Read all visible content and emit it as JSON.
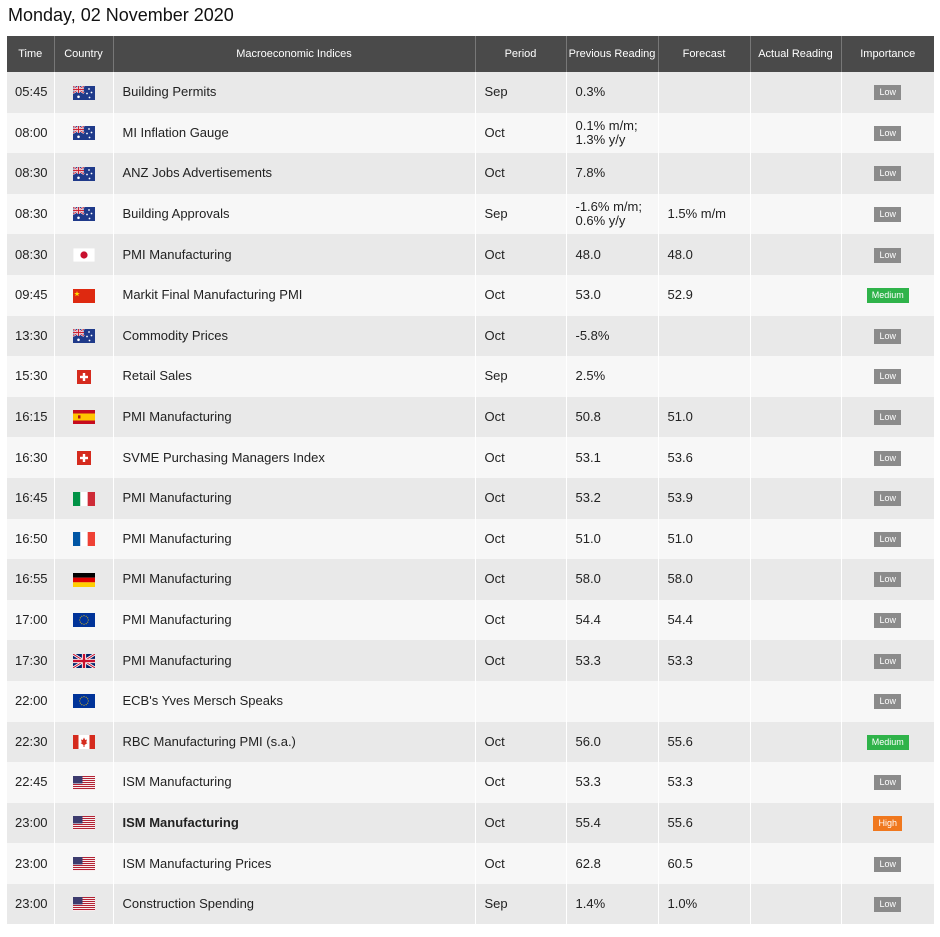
{
  "page": {
    "title": "Monday, 02 November 2020"
  },
  "table": {
    "headers": {
      "time": "Time",
      "country": "Country",
      "index": "Macroeconomic Indices",
      "period": "Period",
      "previous": "Previous Reading",
      "forecast": "Forecast",
      "actual": "Actual Reading",
      "importance": "Importance"
    },
    "rows": [
      {
        "time": "05:45",
        "flag": "australia-flag-icon",
        "index": "Building Permits",
        "period": "Sep",
        "previous": "0.3%",
        "forecast": "",
        "actual": "",
        "importance": "Low"
      },
      {
        "time": "08:00",
        "flag": "australia-flag-icon",
        "index": "MI Inflation Gauge",
        "period": "Oct",
        "previous": "0.1% m/m; 1.3% y/y",
        "forecast": "",
        "actual": "",
        "importance": "Low"
      },
      {
        "time": "08:30",
        "flag": "australia-flag-icon",
        "index": "ANZ Jobs Advertisements",
        "period": "Oct",
        "previous": "7.8%",
        "forecast": "",
        "actual": "",
        "importance": "Low"
      },
      {
        "time": "08:30",
        "flag": "australia-flag-icon",
        "index": "Building Approvals",
        "period": "Sep",
        "previous": "-1.6% m/m; 0.6% y/y",
        "forecast": "1.5% m/m",
        "actual": "",
        "importance": "Low"
      },
      {
        "time": "08:30",
        "flag": "japan-flag-icon",
        "index": "PMI Manufacturing",
        "period": "Oct",
        "previous": "48.0",
        "forecast": "48.0",
        "actual": "",
        "importance": "Low"
      },
      {
        "time": "09:45",
        "flag": "china-flag-icon",
        "index": "Markit Final Manufacturing PMI",
        "period": "Oct",
        "previous": "53.0",
        "forecast": "52.9",
        "actual": "",
        "importance": "Medium"
      },
      {
        "time": "13:30",
        "flag": "australia-flag-icon",
        "index": "Commodity Prices",
        "period": "Oct",
        "previous": "-5.8%",
        "forecast": "",
        "actual": "",
        "importance": "Low"
      },
      {
        "time": "15:30",
        "flag": "switzerland-flag-icon",
        "index": "Retail Sales",
        "period": "Sep",
        "previous": "2.5%",
        "forecast": "",
        "actual": "",
        "importance": "Low"
      },
      {
        "time": "16:15",
        "flag": "spain-flag-icon",
        "index": "PMI Manufacturing",
        "period": "Oct",
        "previous": "50.8",
        "forecast": "51.0",
        "actual": "",
        "importance": "Low"
      },
      {
        "time": "16:30",
        "flag": "switzerland-flag-icon",
        "index": "SVME Purchasing Managers Index",
        "period": "Oct",
        "previous": "53.1",
        "forecast": "53.6",
        "actual": "",
        "importance": "Low"
      },
      {
        "time": "16:45",
        "flag": "italy-flag-icon",
        "index": "PMI Manufacturing",
        "period": "Oct",
        "previous": "53.2",
        "forecast": "53.9",
        "actual": "",
        "importance": "Low"
      },
      {
        "time": "16:50",
        "flag": "france-flag-icon",
        "index": "PMI Manufacturing",
        "period": "Oct",
        "previous": "51.0",
        "forecast": "51.0",
        "actual": "",
        "importance": "Low"
      },
      {
        "time": "16:55",
        "flag": "germany-flag-icon",
        "index": "PMI Manufacturing",
        "period": "Oct",
        "previous": "58.0",
        "forecast": "58.0",
        "actual": "",
        "importance": "Low"
      },
      {
        "time": "17:00",
        "flag": "eu-flag-icon",
        "index": "PMI Manufacturing",
        "period": "Oct",
        "previous": "54.4",
        "forecast": "54.4",
        "actual": "",
        "importance": "Low"
      },
      {
        "time": "17:30",
        "flag": "uk-flag-icon",
        "index": "PMI Manufacturing",
        "period": "Oct",
        "previous": "53.3",
        "forecast": "53.3",
        "actual": "",
        "importance": "Low"
      },
      {
        "time": "22:00",
        "flag": "eu-flag-icon",
        "index": "ECB's Yves Mersch Speaks",
        "period": "",
        "previous": "",
        "forecast": "",
        "actual": "",
        "importance": "Low"
      },
      {
        "time": "22:30",
        "flag": "canada-flag-icon",
        "index": "RBC Manufacturing PMI (s.a.)",
        "period": "Oct",
        "previous": "56.0",
        "forecast": "55.6",
        "actual": "",
        "importance": "Medium"
      },
      {
        "time": "22:45",
        "flag": "usa-flag-icon",
        "index": "ISM Manufacturing",
        "period": "Oct",
        "previous": "53.3",
        "forecast": "53.3",
        "actual": "",
        "importance": "Low"
      },
      {
        "time": "23:00",
        "flag": "usa-flag-icon",
        "index": "ISM Manufacturing",
        "period": "Oct",
        "previous": "55.4",
        "forecast": "55.6",
        "actual": "",
        "importance": "High",
        "bold": true
      },
      {
        "time": "23:00",
        "flag": "usa-flag-icon",
        "index": "ISM Manufacturing Prices",
        "period": "Oct",
        "previous": "62.8",
        "forecast": "60.5",
        "actual": "",
        "importance": "Low"
      },
      {
        "time": "23:00",
        "flag": "usa-flag-icon",
        "index": "Construction Spending",
        "period": "Sep",
        "previous": "1.4%",
        "forecast": "1.0%",
        "actual": "",
        "importance": "Low"
      }
    ]
  },
  "colors": {
    "header_bg": "#4a4a4a",
    "row_odd": "#e9e9e9",
    "row_even": "#f7f7f7",
    "low": "#8b8b8b",
    "medium": "#2fb34a",
    "high": "#f0781e"
  }
}
